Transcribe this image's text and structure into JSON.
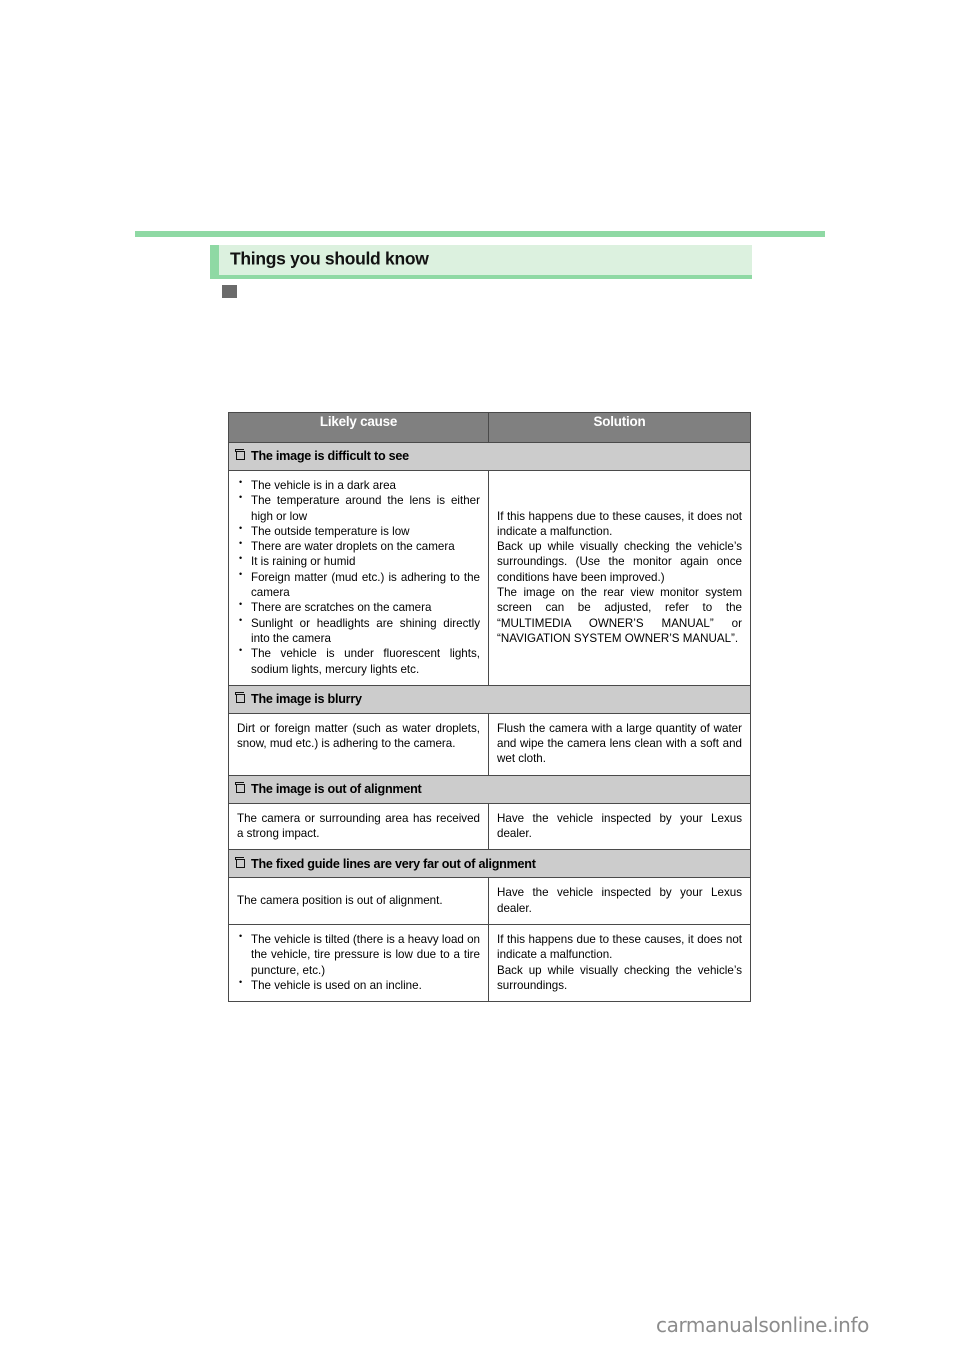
{
  "page": {
    "section_title": "Things you should know",
    "watermark": "carmanualsonline.info",
    "accent_green": "#8fd9a4",
    "accent_green_light": "#dcf1df",
    "header_gray": "#808080",
    "group_gray": "#cccccc",
    "marker_gray": "#6b6b6b"
  },
  "table": {
    "headers": {
      "likely_cause": "Likely cause",
      "solution": "Solution"
    },
    "groups": [
      {
        "title": "The image is difficult to see",
        "rows": [
          {
            "cause_bullets": [
              "The vehicle is in a dark area",
              "The temperature around the lens is either high or low",
              "The outside temperature is low",
              "There are water droplets on the camera",
              "It is raining or humid",
              "Foreign matter (mud etc.) is adhering to the camera",
              "There are scratches on the camera",
              "Sunlight or headlights are shining directly into the camera",
              "The vehicle is under fluorescent lights, sodium lights, mercury lights etc."
            ],
            "solution_paragraphs": [
              "If this happens due to these causes, it does not indicate a malfunction.",
              "Back up while visually checking the vehicle’s surroundings. (Use the monitor again once conditions have been improved.)",
              "The image on the rear view monitor system screen can be adjusted, refer to the “MULTIMEDIA OWNER’S MANUAL” or “NAVIGATION SYSTEM OWNER’S MANUAL”."
            ]
          }
        ]
      },
      {
        "title": "The image is blurry",
        "rows": [
          {
            "cause_text": "Dirt or foreign matter (such as water droplets, snow, mud etc.) is adhering to the camera.",
            "solution_text": "Flush the camera with a large quantity of water and wipe the camera lens clean with a soft and wet cloth."
          }
        ]
      },
      {
        "title": "The image is out of alignment",
        "rows": [
          {
            "cause_text": "The camera or surrounding area has received a strong impact.",
            "solution_text": "Have the vehicle inspected by your Lexus dealer."
          }
        ]
      },
      {
        "title": "The fixed guide lines are very far out of alignment",
        "rows": [
          {
            "cause_text": "The camera position is out of alignment.",
            "solution_text": "Have the vehicle inspected by your Lexus dealer."
          },
          {
            "cause_bullets": [
              "The vehicle is tilted (there is a heavy load on the vehicle, tire pressure is low due to a tire puncture, etc.)",
              "The vehicle is used on an incline."
            ],
            "solution_paragraphs": [
              "If this happens due to these causes, it does not indicate a malfunction.",
              "Back up while visually checking the vehicle’s surroundings."
            ]
          }
        ]
      }
    ]
  }
}
